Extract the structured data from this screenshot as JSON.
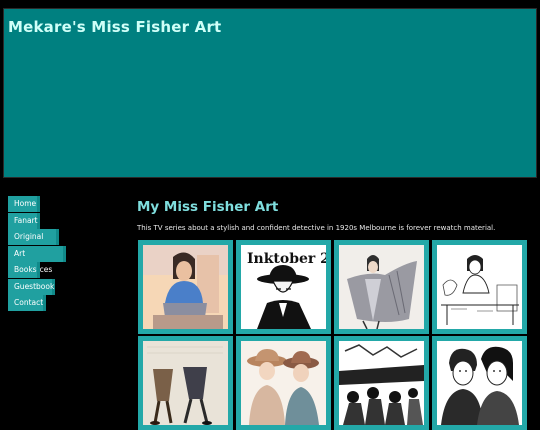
{
  "site": {
    "title": "Mekare's Miss Fisher Art"
  },
  "nav": {
    "items": [
      "Home",
      "Fanart",
      "Original Art",
      "Art Resources",
      "Books",
      "Guestbook",
      "Contact"
    ]
  },
  "main": {
    "title": "My Miss Fisher Art",
    "intro": "This TV series about a stylish and confident detective in 1920s Melbourne is forever rewatch material."
  },
  "gallery": {
    "thumbnails": [
      {
        "name": "thumb-seated-woman-blue-top",
        "caption": ""
      },
      {
        "name": "thumb-inktober-hat-man",
        "caption": "Inktober 2"
      },
      {
        "name": "thumb-woman-spreading-shawl",
        "caption": ""
      },
      {
        "name": "thumb-woman-at-table-sketch",
        "caption": ""
      },
      {
        "name": "thumb-dancing-legs",
        "caption": ""
      },
      {
        "name": "thumb-two-women-in-hats",
        "caption": ""
      },
      {
        "name": "thumb-crowd-ink-scene",
        "caption": ""
      },
      {
        "name": "thumb-couple-portrait",
        "caption": ""
      }
    ]
  },
  "colors": {
    "banner": "#008080",
    "nav_item": "#20a0a0",
    "title": "#7fdede",
    "thumb_frame": "#23a8a8"
  }
}
